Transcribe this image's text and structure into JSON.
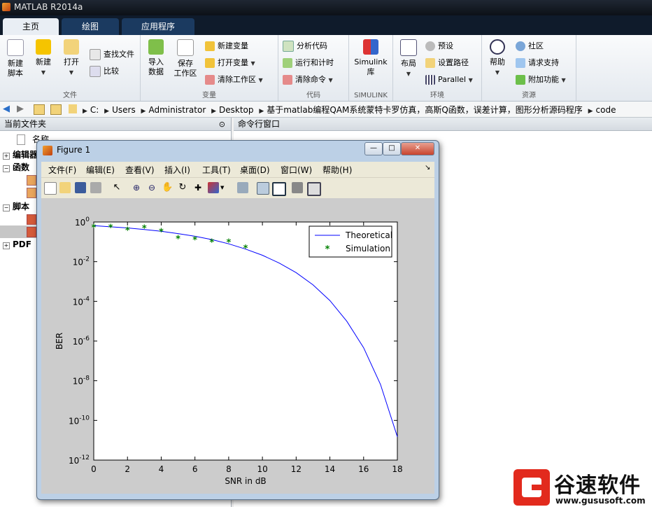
{
  "app": {
    "title": "MATLAB R2014a"
  },
  "tabs": [
    {
      "label": "主页"
    },
    {
      "label": "绘图"
    },
    {
      "label": "应用程序"
    }
  ],
  "ribbon": {
    "file": {
      "group": "文件",
      "new_script": "新建\n脚本",
      "new": "新建",
      "open": "打开",
      "find_files": "查找文件",
      "compare": "比较"
    },
    "variable": {
      "group": "变量",
      "import": "导入\n数据",
      "save_ws": "保存\n工作区",
      "new_var": "新建变量",
      "open_var": "打开变量",
      "clear_ws": "清除工作区"
    },
    "code": {
      "group": "代码",
      "analyze": "分析代码",
      "run_time": "运行和计时",
      "clear_cmd": "清除命令"
    },
    "simulink": {
      "group": "SIMULINK",
      "lib": "Simulink\n库"
    },
    "env": {
      "group": "环境",
      "layout": "布局",
      "prefs": "预设",
      "set_path": "设置路径",
      "parallel": "Parallel"
    },
    "res": {
      "group": "资源",
      "help": "帮助",
      "community": "社区",
      "support": "请求支持",
      "addons": "附加功能"
    }
  },
  "address": {
    "crumbs": [
      "C:",
      "Users",
      "Administrator",
      "Desktop",
      "基于matlab编程QAM系统蒙特卡罗仿真，高斯Q函数，误差计算，图形分析源码程序",
      "code"
    ]
  },
  "left_panel": {
    "header": "当前文件夹",
    "rows": [
      "名称",
      "编辑器",
      "函数",
      "脚本",
      "PDF"
    ]
  },
  "command_panel": {
    "header": "命令行窗口"
  },
  "figure": {
    "title": "Figure 1",
    "menu": [
      "文件(F)",
      "编辑(E)",
      "查看(V)",
      "插入(I)",
      "工具(T)",
      "桌面(D)",
      "窗口(W)",
      "帮助(H)"
    ]
  },
  "chart_data": {
    "type": "line",
    "title": "",
    "xlabel": "SNR in dB",
    "ylabel": "BER",
    "xlim": [
      0,
      18
    ],
    "ylim": [
      1e-12,
      1
    ],
    "yscale": "log",
    "xticks": [
      "0",
      "2",
      "4",
      "6",
      "8",
      "10",
      "12",
      "14",
      "16",
      "18"
    ],
    "yticks": [
      {
        "base": "10",
        "exp": "0"
      },
      {
        "base": "10",
        "exp": "-2"
      },
      {
        "base": "10",
        "exp": "-4"
      },
      {
        "base": "10",
        "exp": "-6"
      },
      {
        "base": "10",
        "exp": "-8"
      },
      {
        "base": "10",
        "exp": "-10"
      },
      {
        "base": "10",
        "exp": "-12"
      }
    ],
    "legend": "top-right",
    "series": [
      {
        "name": "Theoretical",
        "style": "line",
        "color": "#0000ff",
        "x": [
          0,
          1,
          2,
          3,
          4,
          5,
          6,
          7,
          8,
          9,
          10,
          11,
          12,
          13,
          14,
          15,
          16,
          17,
          18
        ],
        "y": [
          0.65,
          0.57,
          0.5,
          0.42,
          0.34,
          0.26,
          0.19,
          0.13,
          0.079,
          0.043,
          0.021,
          0.0085,
          0.0028,
          0.00068,
          0.00011,
          1e-05,
          4.6e-07,
          6.5e-09,
          1.5e-11
        ]
      },
      {
        "name": "Simulation",
        "style": "marker",
        "color": "#008000",
        "x": [
          0,
          1,
          2,
          3,
          4,
          5,
          6,
          7,
          8,
          9
        ],
        "y": [
          0.55,
          0.55,
          0.4,
          0.5,
          0.33,
          0.15,
          0.13,
          0.1,
          0.1,
          0.05
        ]
      }
    ]
  },
  "watermark": {
    "brand": "谷速软件",
    "url": "www.gususoft.com"
  },
  "colors": {
    "accent": "#1b3a60",
    "ribbon_bg": "#eef1f5"
  }
}
